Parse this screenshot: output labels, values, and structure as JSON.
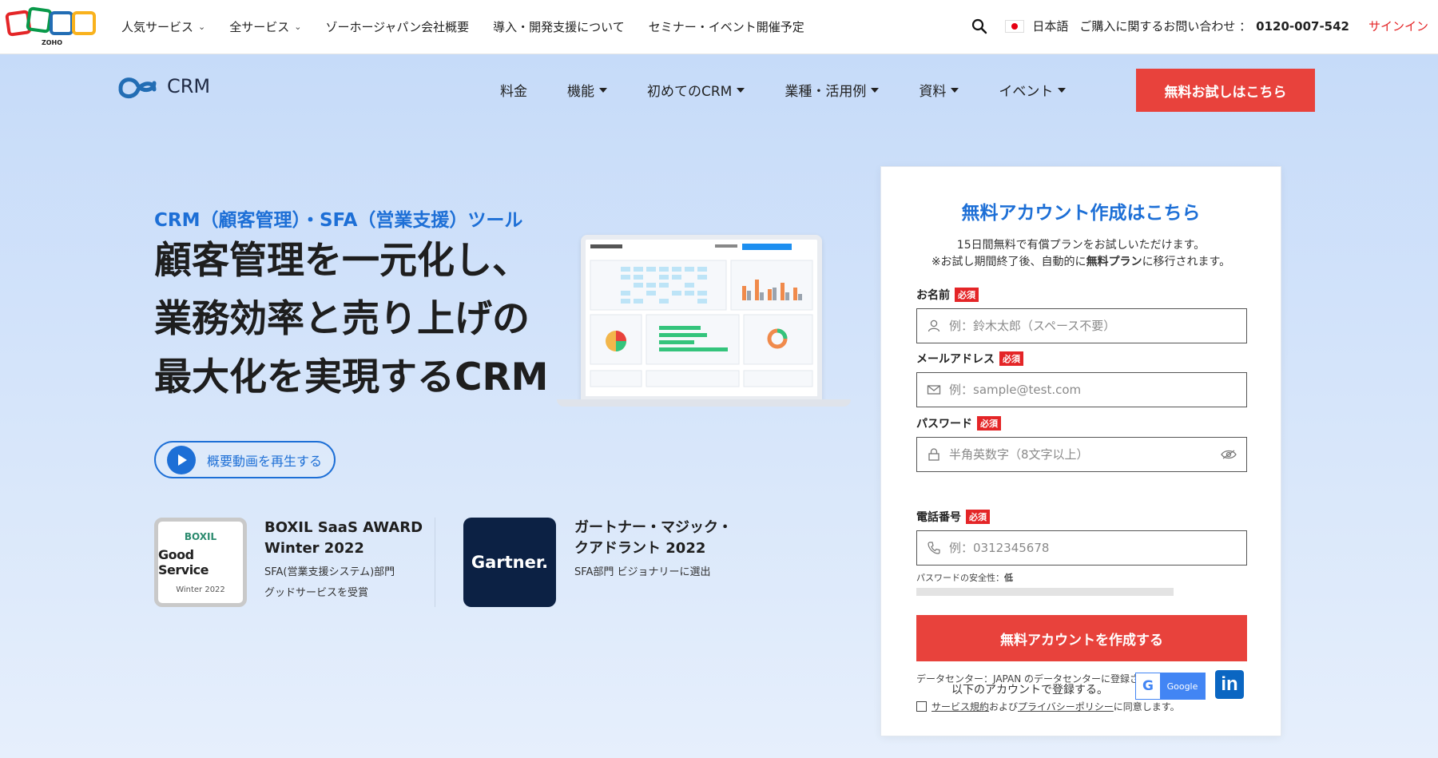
{
  "topbar": {
    "brand": "ZOHO",
    "nav": [
      {
        "label": "人気サービス",
        "has_dropdown": true
      },
      {
        "label": "全サービス",
        "has_dropdown": true
      },
      {
        "label": "ゾーホージャパン会社概要",
        "has_dropdown": false
      },
      {
        "label": "導入・開発支援について",
        "has_dropdown": false
      },
      {
        "label": "セミナー・イベント開催予定",
        "has_dropdown": false
      }
    ],
    "language": "日本語",
    "contact_label": "ご購入に関するお問い合わせ ：",
    "phone": "0120-007-542",
    "signin": "サインイン"
  },
  "header": {
    "product_name": "CRM",
    "nav": [
      {
        "label": "料金",
        "has_dropdown": false
      },
      {
        "label": "機能",
        "has_dropdown": true
      },
      {
        "label": "初めてのCRM",
        "has_dropdown": true
      },
      {
        "label": "業種・活用例",
        "has_dropdown": true
      },
      {
        "label": "資料",
        "has_dropdown": true
      },
      {
        "label": "イベント",
        "has_dropdown": true
      }
    ],
    "cta": "無料お試しはこちら"
  },
  "hero": {
    "subtitle": "CRM（顧客管理）・SFA（営業支援）ツール",
    "headline_lines": [
      "顧客管理を一元化し、",
      "業務効率と売り上げの",
      "最大化を実現するCRM"
    ],
    "video_button": "概要動画を再生する"
  },
  "awards": [
    {
      "badge_lines": [
        "BOXIL",
        "Good Service",
        "Winter 2022"
      ],
      "title_lines": [
        "BOXIL SaaS AWARD",
        "Winter 2022"
      ],
      "desc_lines": [
        "SFA(営業支援システム)部門",
        "グッドサービスを受賞"
      ]
    },
    {
      "badge_text": "Gartner.",
      "title_lines": [
        "ガートナー・マジック・",
        "クアドラント 2022"
      ],
      "desc_lines": [
        "SFA部門 ビジョナリーに選出"
      ]
    }
  ],
  "signup_form": {
    "title": "無料アカウント作成はこちら",
    "intro_line1": "15日間無料で有償プランをお試しいただけます。",
    "intro_line2_pre": "※お試し期間終了後、自動的に",
    "intro_line2_bold": "無料プラン",
    "intro_line2_post": "に移行されます。",
    "required_badge": "必須",
    "fields": {
      "name": {
        "label": "お名前",
        "placeholder": "例：鈴木太郎（スペース不要）",
        "value": ""
      },
      "email": {
        "label": "メールアドレス",
        "placeholder": "例：sample@test.com",
        "value": ""
      },
      "password": {
        "label": "パスワード",
        "placeholder": "半角英数字（8文字以上）",
        "value": ""
      },
      "phone": {
        "label": "電話番号",
        "placeholder": "例：0312345678",
        "value": ""
      }
    },
    "password_strength_label": "パスワードの安全性：",
    "password_strength_value": "低",
    "datacenter_note": "データセンター：JAPAN のデータセンターに登録されます。",
    "agree_terms_link": "サービス規約",
    "agree_and": "および",
    "agree_privacy_link": "プライバシーポリシー",
    "agree_suffix": "に同意します。",
    "submit": "無料アカウントを作成する",
    "social_note": "以下のアカウントで登録する。",
    "google_label": "Google",
    "linkedin_label": "in"
  },
  "colors": {
    "accent_blue": "#1d6fd6",
    "cta_red": "#e8423c",
    "signin_red": "#e42527"
  }
}
